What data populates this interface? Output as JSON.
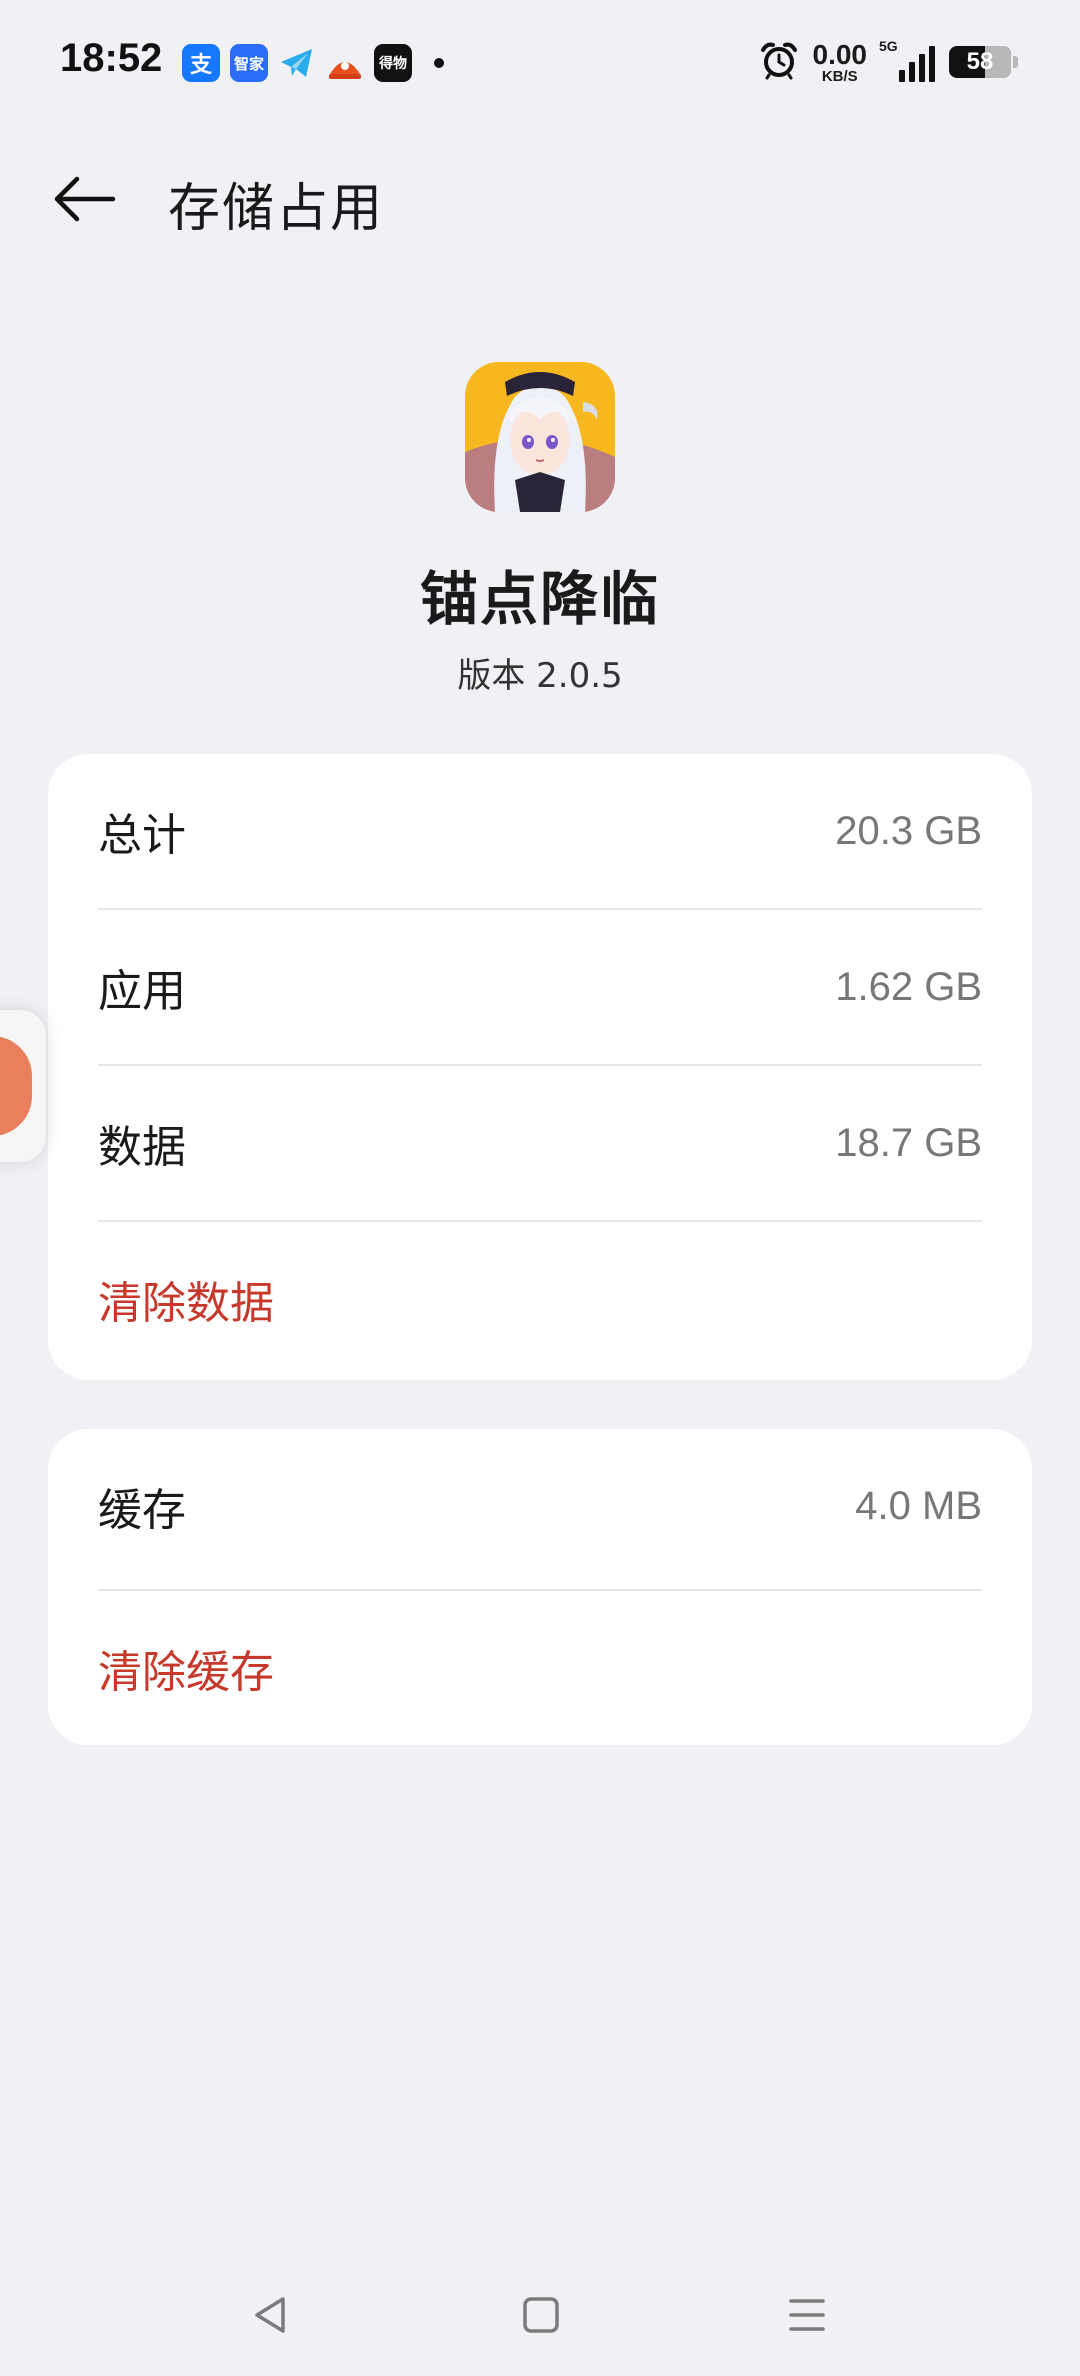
{
  "status_bar": {
    "time": "18:52",
    "net_speed_value": "0.00",
    "net_speed_unit": "KB/S",
    "network_type": "5G",
    "battery_level": "58",
    "notification_icons": [
      {
        "name": "alipay-icon",
        "glyph": "支",
        "color": "#1677ff"
      },
      {
        "name": "smart-home-icon",
        "glyph": "智家",
        "color": "#2b6cf6"
      },
      {
        "name": "telegram-icon",
        "glyph": "",
        "color": "#2aabee"
      },
      {
        "name": "taobao-icon",
        "glyph": "",
        "color": "#e8501f"
      },
      {
        "name": "dewu-icon",
        "glyph": "得物",
        "color": "#111111"
      }
    ],
    "alarm_icon": "alarm-clock-icon"
  },
  "header": {
    "back_icon": "arrow-left-icon",
    "title": "存储占用"
  },
  "app": {
    "name": "锚点降临",
    "version": "版本  2.0.5",
    "icon": "app-character-icon"
  },
  "storage": {
    "rows": [
      {
        "label": "总计",
        "value": "20.3 GB"
      },
      {
        "label": "应用",
        "value": "1.62 GB"
      },
      {
        "label": "数据",
        "value": "18.7 GB"
      }
    ],
    "clear_action": "清除数据"
  },
  "cache": {
    "label": "缓存",
    "value": "4.0 MB",
    "clear_action": "清除缓存"
  },
  "colors": {
    "background": "#f0f1f5",
    "card": "#ffffff",
    "accent_red": "#c7392b",
    "secondary_text": "#777777"
  },
  "nav_bar": {
    "back": "triangle-back-icon",
    "home": "square-home-icon",
    "recents": "menu-lines-icon"
  }
}
